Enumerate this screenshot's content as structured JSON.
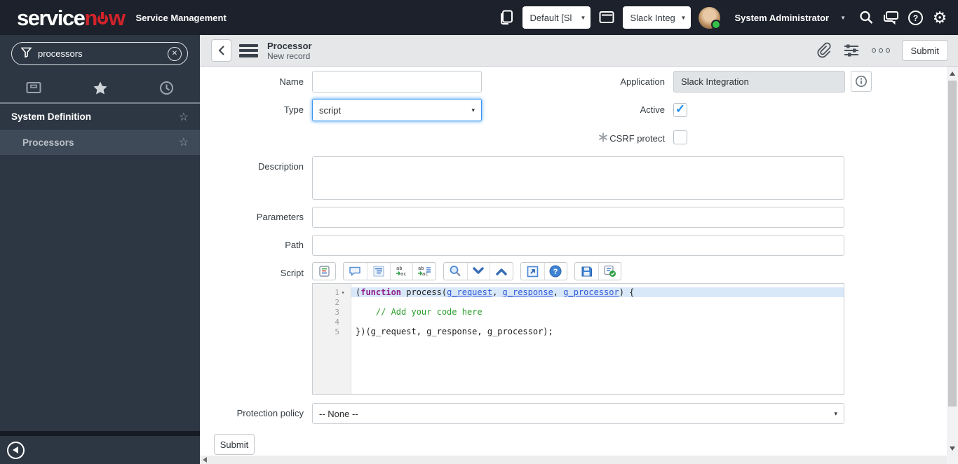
{
  "colors": {
    "header_bg": "#1c212b",
    "sidebar_bg": "#2d3743",
    "selected_nav_bg": "#3e4a57",
    "brand_red": "#d1232a",
    "focus_blue": "#3996f0",
    "check_blue": "#1d8ceb",
    "keyword_color": "#8f1e8a",
    "param_color": "#2e58d8",
    "comment_color": "#2d9e2d",
    "active_line_bg": "#d9e8f8"
  },
  "header": {
    "logo": {
      "white_part": "service",
      "red_before_o": "n",
      "red_after_o": "w"
    },
    "product": "Service Management",
    "update_set_value": "Default [Sl",
    "application_value": "Slack Integ",
    "user": "System Administrator",
    "icons": [
      "pages-icon",
      "window-icon",
      "search-icon",
      "chat-icon",
      "help-icon",
      "gear-icon"
    ],
    "gear_glyph": "⚙"
  },
  "sidebar": {
    "search_value": "processors",
    "search_icon": "funnel-icon",
    "clear_glyph": "✕",
    "tabs": [
      "all-applications-icon",
      "favorites-star-icon",
      "history-clock-icon"
    ],
    "section_label": "System Definition",
    "item_label": "Processors",
    "star_glyph": "☆"
  },
  "form_header": {
    "title": "Processor",
    "subtitle": "New record",
    "submit_label": "Submit",
    "icons": [
      "attachment-paperclip-icon",
      "personalize-form-icon",
      "more-options-icon"
    ]
  },
  "form": {
    "name": {
      "label": "Name",
      "value": ""
    },
    "type": {
      "label": "Type",
      "value": "script",
      "caret": "▾"
    },
    "application": {
      "label": "Application",
      "value": "Slack Integration"
    },
    "active": {
      "label": "Active",
      "checked": true,
      "check_glyph": "✓"
    },
    "csrf": {
      "label": "CSRF protect",
      "checked": false,
      "check_glyph": "✓"
    },
    "description": {
      "label": "Description",
      "value": ""
    },
    "parameters": {
      "label": "Parameters",
      "value": ""
    },
    "path": {
      "label": "Path",
      "value": ""
    },
    "protection_policy": {
      "label": "Protection policy",
      "value": "-- None --",
      "caret": "▾"
    },
    "submit_label": "Submit",
    "script": {
      "label": "Script",
      "toolbar_icons": [
        "script-syntax-icon",
        "comment-icon",
        "format-code-icon",
        "replace-icon",
        "replace-all-icon",
        "search-code-icon",
        "find-next-icon",
        "find-previous-icon",
        "open-new-window-icon",
        "editor-help-icon",
        "save-icon",
        "syntax-check-icon"
      ],
      "fold_glyph": "▾",
      "lines": [
        {
          "n": 1,
          "fold": true,
          "active": true,
          "segments": [
            {
              "t": "("
            },
            {
              "t": "function",
              "s": "keyword"
            },
            {
              "t": " process("
            },
            {
              "t": "g_request",
              "s": "param"
            },
            {
              "t": ", "
            },
            {
              "t": "g_response",
              "s": "param"
            },
            {
              "t": ", "
            },
            {
              "t": "g_processor",
              "s": "param"
            },
            {
              "t": ") {"
            }
          ]
        },
        {
          "n": 2,
          "segments": []
        },
        {
          "n": 3,
          "segments": [
            {
              "t": "    // Add your code here",
              "s": "comment"
            }
          ]
        },
        {
          "n": 4,
          "segments": []
        },
        {
          "n": 5,
          "segments": [
            {
              "t": "})(g_request, g_response, g_processor);"
            }
          ]
        }
      ]
    }
  }
}
